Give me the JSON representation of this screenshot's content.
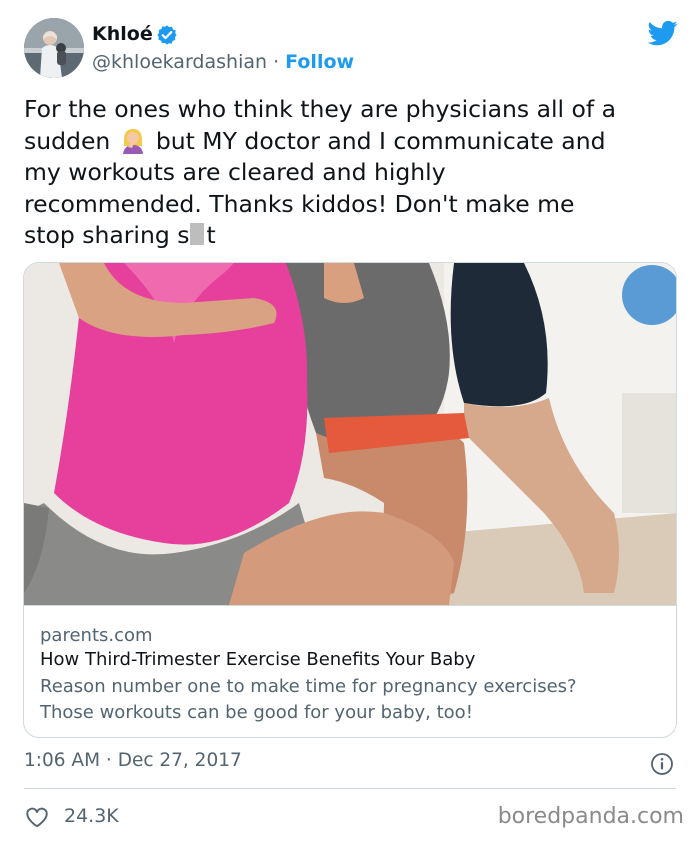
{
  "author": {
    "name": "Khloé",
    "handle": "@khloekardashian",
    "separator": " · ",
    "follow_label": "Follow"
  },
  "tweet": {
    "lines": [
      "For the ones who think they are physicians all of a",
      "sudden",
      "but MY doctor and I communicate and",
      "my workouts are cleared and highly",
      "recommended. Thanks kiddos! Don't make me",
      "stop sharing s",
      "t"
    ]
  },
  "link_card": {
    "domain": "parents.com",
    "title": "How Third-Trimester Exercise Benefits Your Baby",
    "description_lines": [
      "Reason number one to make time for pregnancy exercises?",
      "Those workouts can be good for your baby, too!"
    ]
  },
  "meta": {
    "time": "1:06 AM",
    "separator": " · ",
    "date": "Dec 27, 2017"
  },
  "engagement": {
    "likes": "24.3K"
  },
  "watermark": "boredpanda.com",
  "colors": {
    "link_blue": "#1d9bf0",
    "text_primary": "#0f1419",
    "text_secondary": "#536471",
    "border": "#cfd9de",
    "shirt_pink": "#e6409c"
  },
  "icons": [
    "verified-badge-icon",
    "twitter-bird-icon",
    "woman-facepalming-emoji-icon",
    "info-icon",
    "heart-icon"
  ]
}
